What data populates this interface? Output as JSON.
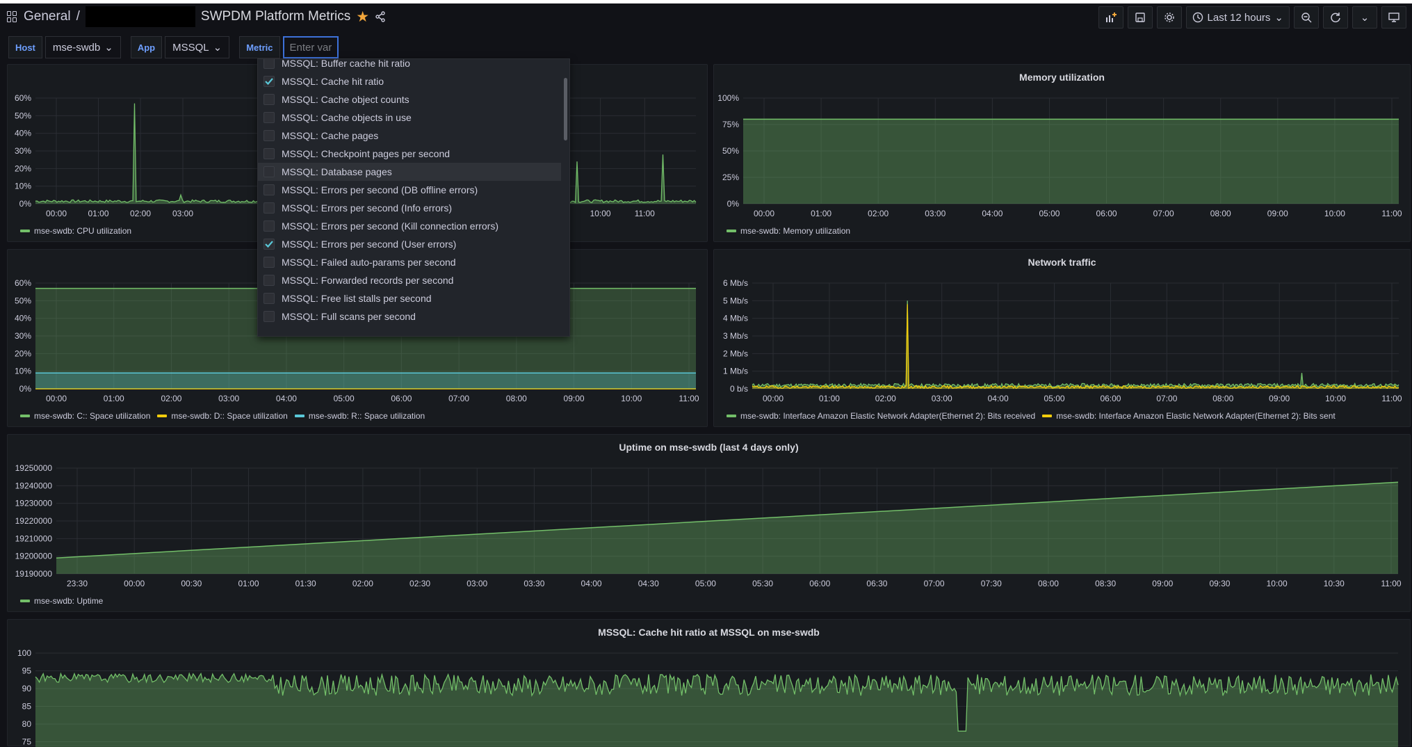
{
  "header": {
    "breadcrumb_root": "General",
    "separator": "/",
    "title": "SWPDM Platform Metrics",
    "time_range": "Last 12 hours"
  },
  "variables": {
    "host_label": "Host",
    "host_value": "mse-swdb",
    "app_label": "App",
    "app_value": "MSSQL",
    "metric_label": "Metric",
    "metric_placeholder": "Enter vari"
  },
  "dropdown": {
    "items": [
      {
        "label": "MSSQL: Buffer cache hit ratio",
        "checked": false,
        "highlighted": false
      },
      {
        "label": "MSSQL: Cache hit ratio",
        "checked": true,
        "highlighted": false
      },
      {
        "label": "MSSQL: Cache object counts",
        "checked": false,
        "highlighted": false
      },
      {
        "label": "MSSQL: Cache objects in use",
        "checked": false,
        "highlighted": false
      },
      {
        "label": "MSSQL: Cache pages",
        "checked": false,
        "highlighted": false
      },
      {
        "label": "MSSQL: Checkpoint pages per second",
        "checked": false,
        "highlighted": false
      },
      {
        "label": "MSSQL: Database pages",
        "checked": false,
        "highlighted": true
      },
      {
        "label": "MSSQL: Errors per second (DB offline errors)",
        "checked": false,
        "highlighted": false
      },
      {
        "label": "MSSQL: Errors per second (Info errors)",
        "checked": false,
        "highlighted": false
      },
      {
        "label": "MSSQL: Errors per second (Kill connection errors)",
        "checked": false,
        "highlighted": false
      },
      {
        "label": "MSSQL: Errors per second (User errors)",
        "checked": true,
        "highlighted": false
      },
      {
        "label": "MSSQL: Failed auto-params per second",
        "checked": false,
        "highlighted": false
      },
      {
        "label": "MSSQL: Forwarded records per second",
        "checked": false,
        "highlighted": false
      },
      {
        "label": "MSSQL: Free list stalls per second",
        "checked": false,
        "highlighted": false
      },
      {
        "label": "MSSQL: Full scans per second",
        "checked": false,
        "highlighted": false
      }
    ]
  },
  "panels": {
    "cpu": {
      "legend": [
        "mse-swdb: CPU utilization"
      ]
    },
    "memory": {
      "title": "Memory utilization",
      "legend": [
        "mse-swdb: Memory utilization"
      ]
    },
    "disk": {
      "legend": [
        "mse-swdb: C:: Space utilization",
        "mse-swdb: D:: Space utilization",
        "mse-swdb: R:: Space utilization"
      ]
    },
    "network": {
      "title": "Network traffic",
      "legend": [
        "mse-swdb: Interface Amazon Elastic Network Adapter(Ethernet 2): Bits received",
        "mse-swdb: Interface Amazon Elastic Network Adapter(Ethernet 2): Bits sent"
      ]
    },
    "uptime": {
      "title": "Uptime on mse-swdb (last 4 days only)",
      "legend": [
        "mse-swdb: Uptime"
      ]
    },
    "cache": {
      "title": "MSSQL: Cache hit ratio at MSSQL on mse-swdb"
    }
  },
  "colors": {
    "green": "#73bf69",
    "yellow": "#f2cc0c",
    "cyan": "#5ac8d8",
    "accent": "#3d71d9",
    "star": "#f2a63b"
  },
  "chart_data": [
    {
      "id": "cpu",
      "type": "line",
      "ylabels": [
        "60%",
        "50%",
        "40%",
        "30%",
        "20%",
        "10%",
        "0%"
      ],
      "xlabels": [
        "00:00",
        "01:00",
        "02:00",
        "03:00",
        "10:00",
        "11:00"
      ],
      "ylim": [
        0,
        60
      ],
      "series": [
        {
          "name": "mse-swdb: CPU utilization",
          "baseline": 1.5,
          "spikes": [
            [
              0.15,
              57
            ],
            [
              0.22,
              5
            ],
            [
              0.82,
              24
            ],
            [
              0.95,
              28
            ]
          ]
        }
      ]
    },
    {
      "id": "memory",
      "type": "area",
      "ylabels": [
        "100%",
        "75%",
        "50%",
        "25%",
        "0%"
      ],
      "xlabels": [
        "00:00",
        "01:00",
        "02:00",
        "03:00",
        "04:00",
        "05:00",
        "06:00",
        "07:00",
        "08:00",
        "09:00",
        "10:00",
        "11:00"
      ],
      "ylim": [
        0,
        100
      ],
      "series": [
        {
          "name": "mse-swdb: Memory utilization",
          "value": 80
        }
      ]
    },
    {
      "id": "disk",
      "type": "area",
      "ylabels": [
        "60%",
        "50%",
        "40%",
        "30%",
        "20%",
        "10%",
        "0%"
      ],
      "xlabels": [
        "00:00",
        "01:00",
        "02:00",
        "03:00",
        "04:00",
        "05:00",
        "06:00",
        "07:00",
        "08:00",
        "09:00",
        "10:00",
        "11:00"
      ],
      "ylim": [
        0,
        60
      ],
      "series": [
        {
          "name": "mse-swdb: C:: Space utilization",
          "value": 57
        },
        {
          "name": "mse-swdb: D:: Space utilization",
          "value": 0
        },
        {
          "name": "mse-swdb: R:: Space utilization",
          "value": 9
        }
      ]
    },
    {
      "id": "network",
      "type": "line",
      "ylabels": [
        "6 Mb/s",
        "5 Mb/s",
        "4 Mb/s",
        "3 Mb/s",
        "2 Mb/s",
        "1 Mb/s",
        "0 b/s"
      ],
      "xlabels": [
        "00:00",
        "01:00",
        "02:00",
        "03:00",
        "04:00",
        "05:00",
        "06:00",
        "07:00",
        "08:00",
        "09:00",
        "10:00",
        "11:00"
      ],
      "ylim": [
        0,
        6
      ],
      "series": [
        {
          "name": "Bits received",
          "baseline": 0.2,
          "spikes": [
            [
              0.24,
              5
            ],
            [
              0.85,
              0.9
            ]
          ]
        },
        {
          "name": "Bits sent",
          "baseline": 0.1,
          "spikes": [
            [
              0.24,
              4.8
            ]
          ]
        }
      ]
    },
    {
      "id": "uptime",
      "type": "area",
      "ylabels": [
        "19250000",
        "19240000",
        "19230000",
        "19220000",
        "19210000",
        "19200000",
        "19190000"
      ],
      "xlabels": [
        "23:30",
        "00:00",
        "00:30",
        "01:00",
        "01:30",
        "02:00",
        "02:30",
        "03:00",
        "03:30",
        "04:00",
        "04:30",
        "05:00",
        "05:30",
        "06:00",
        "06:30",
        "07:00",
        "07:30",
        "08:00",
        "08:30",
        "09:00",
        "09:30",
        "10:00",
        "10:30",
        "11:00"
      ],
      "ylim": [
        19190000,
        19250000
      ],
      "series": [
        {
          "name": "mse-swdb: Uptime",
          "start": 19199000,
          "end": 19242000
        }
      ]
    },
    {
      "id": "cache",
      "type": "area",
      "ylabels": [
        "100",
        "95",
        "90",
        "85",
        "80",
        "75"
      ],
      "ylim": [
        75,
        100
      ],
      "series": [
        {
          "name": "Cache hit ratio",
          "mean": 91
        }
      ]
    }
  ]
}
